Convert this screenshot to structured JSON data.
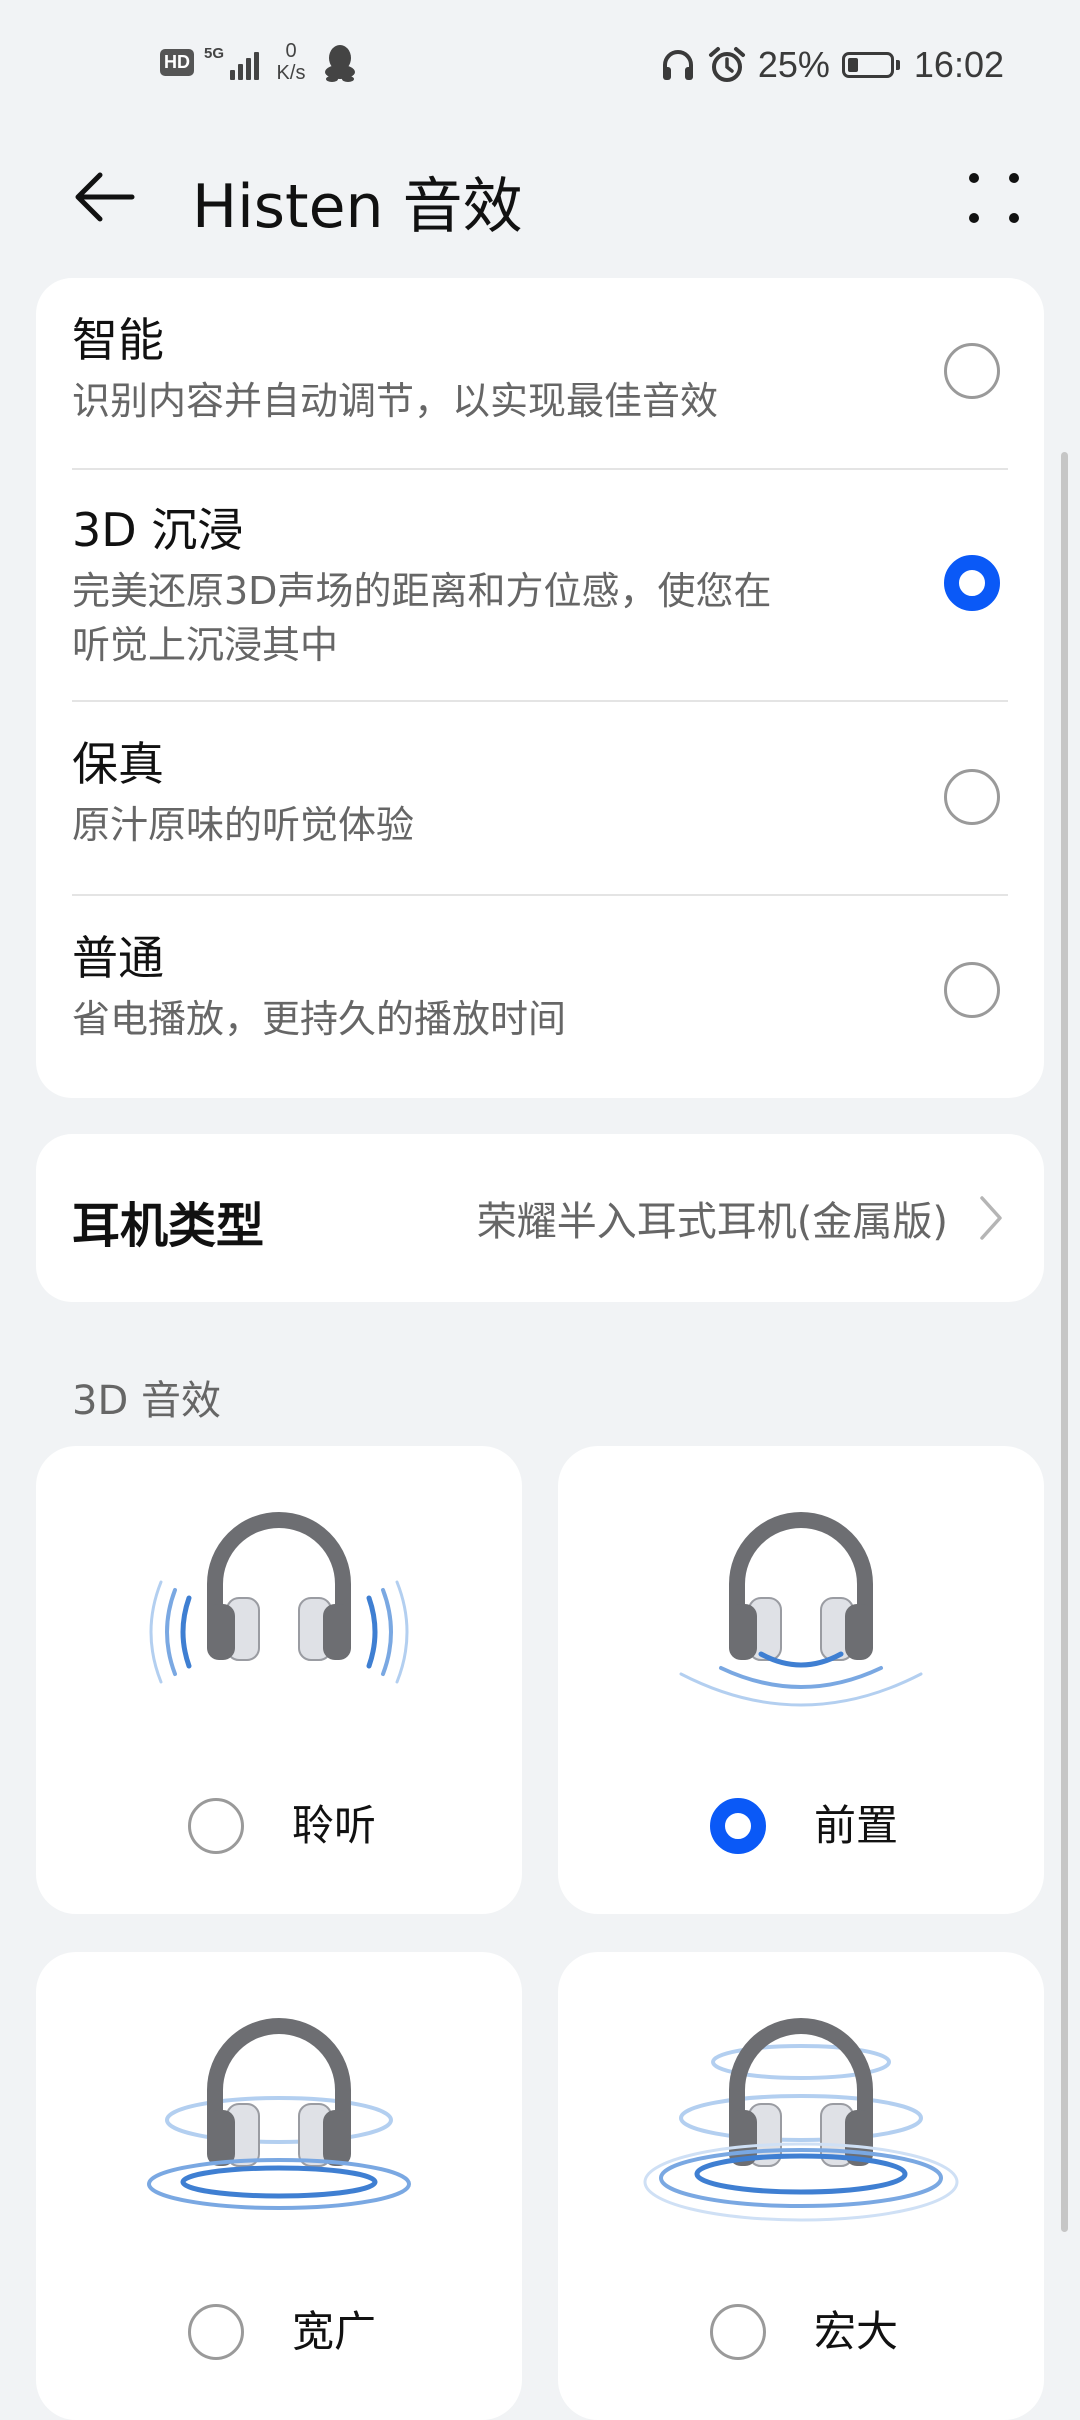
{
  "status_bar": {
    "network_tag": "5G",
    "hd": "HD",
    "speed_value": "0",
    "speed_unit": "K/s",
    "battery": "25%",
    "battery_level": 0.25,
    "time": "16:02"
  },
  "header": {
    "title": "Histen 音效"
  },
  "modes": [
    {
      "title": "智能",
      "desc": "识别内容并自动调节，以实现最佳音效",
      "selected": false
    },
    {
      "title": "3D 沉浸",
      "desc1": "完美还原3D声场的距离和方位感，使您在",
      "desc2": "听觉上沉浸其中",
      "selected": true
    },
    {
      "title": "保真",
      "desc": "原汁原味的听觉体验",
      "selected": false
    },
    {
      "title": "普通",
      "desc": "省电播放，更持久的播放时间",
      "selected": false
    }
  ],
  "headphone_type": {
    "label": "耳机类型",
    "value": "荣耀半入耳式耳机(金属版)"
  },
  "effects_section": {
    "title": "3D 音效",
    "items": [
      {
        "label": "聆听",
        "selected": false
      },
      {
        "label": "前置",
        "selected": true
      },
      {
        "label": "宽广",
        "selected": false
      },
      {
        "label": "宏大",
        "selected": false
      }
    ]
  },
  "colors": {
    "accent": "#0a59f7",
    "background": "#f1f3f5",
    "wave_light": "#a9c8ee",
    "wave_dark": "#3f7fd2",
    "headphone_gray": "#6d6e72"
  },
  "icons": [
    "back-arrow-icon",
    "more-icon",
    "chevron-right-icon",
    "headphones-icon",
    "alarm-icon",
    "battery-icon",
    "signal-icon",
    "qq-icon"
  ]
}
